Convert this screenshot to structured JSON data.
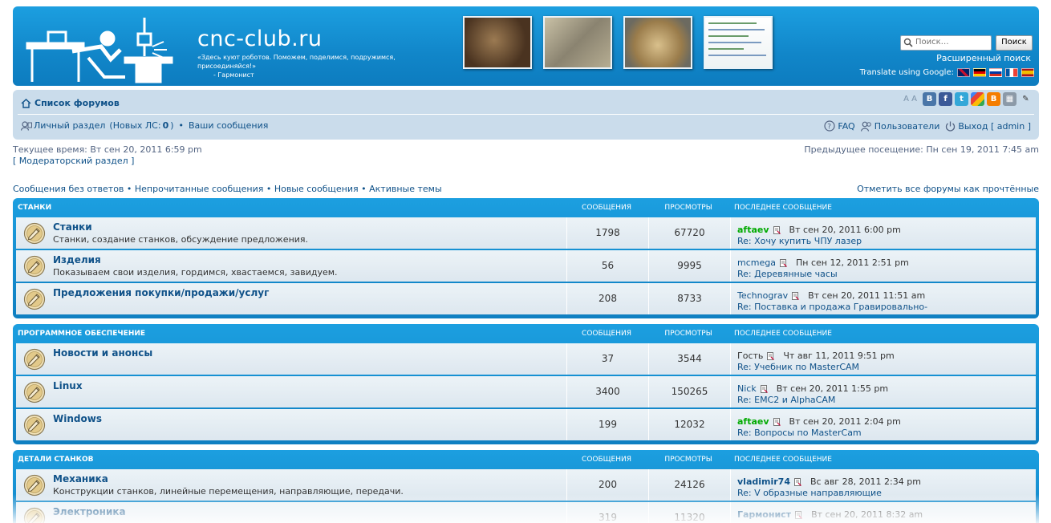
{
  "header": {
    "site_title": "cnc-club.ru",
    "site_description": "«Здесь куют роботов. Поможем, поделимся, подружимся, присоединяйся!»",
    "site_signature": "- Гармонист",
    "search_placeholder": "Поиск…",
    "search_button": "Поиск",
    "advanced_search": "Расширенный поиск",
    "translate_label": "Translate using Google:",
    "flags": [
      "flag-uk-icon",
      "flag-de-icon",
      "flag-ru-icon",
      "flag-fr-icon",
      "flag-es-icon"
    ]
  },
  "navbar": {
    "forum_index": "Список форумов",
    "font_size_control": "A A",
    "profile_link": "Личный раздел",
    "new_pm_prefix": "(Новых ЛС: ",
    "new_pm_count": "0",
    "new_pm_suffix": ")",
    "bullet": "•",
    "your_posts": "Ваши сообщения",
    "faq": "FAQ",
    "members": "Пользователи",
    "logout": "Выход [ admin ]",
    "share_icons": [
      "vkontakte-icon",
      "facebook-icon",
      "twitter-icon",
      "google-icon",
      "blogger-icon",
      "bookmark-icon",
      "edit-icon"
    ]
  },
  "info": {
    "current_time": "Текущее время: Вт сен 20, 2011 6:59 pm",
    "moderator_panel": "[ Модераторский раздел ]",
    "last_visit": "Предыдущее посещение: Пн сен 19, 2011 7:45 am",
    "quick_links": "Сообщения без ответов • Непрочитанные сообщения • Новые сообщения • Активные темы",
    "mark_read": "Отметить все форумы как прочтённые"
  },
  "columns": {
    "posts": "СООБЩЕНИЯ",
    "views": "ПРОСМОТРЫ",
    "last_post": "ПОСЛЕДНЕЕ СООБЩЕНИЕ"
  },
  "categories": [
    {
      "name": "СТАНКИ",
      "forums": [
        {
          "title": "Станки",
          "desc": "Станки, создание станков, обсуждение предложения.",
          "posts": "1798",
          "views": "67720",
          "user": "aftaev",
          "user_style": "green",
          "date": "Вт сен 20, 2011 6:00 pm",
          "topic": "Re: Хочу купить ЧПУ лазер"
        },
        {
          "title": "Изделия",
          "desc": "Показываем свои изделия, гордимся, хвастаемся, завидуем.",
          "posts": "56",
          "views": "9995",
          "user": "mcmega",
          "user_style": "plain",
          "date": "Пн сен 12, 2011 2:51 pm",
          "topic": "Re: Деревянные часы"
        },
        {
          "title": "Предложения покупки/продажи/услуг",
          "desc": "",
          "posts": "208",
          "views": "8733",
          "user": "Technograv",
          "user_style": "plain",
          "date": "Вт сен 20, 2011 11:51 am",
          "topic": "Re: Поставка и продажа Гравировально-"
        }
      ]
    },
    {
      "name": "ПРОГРАММНОЕ ОБЕСПЕЧЕНИЕ",
      "forums": [
        {
          "title": "Новости и анонсы",
          "desc": "",
          "posts": "37",
          "views": "3544",
          "user": "Гость",
          "user_style": "gray",
          "date": "Чт авг 11, 2011 9:51 pm",
          "topic": "Re: Учебник по MasterCAM"
        },
        {
          "title": "Linux",
          "desc": "",
          "posts": "3400",
          "views": "150265",
          "user": "Nick",
          "user_style": "plain",
          "date": "Вт сен 20, 2011 1:55 pm",
          "topic": "Re: EMC2 и AlphaCAM"
        },
        {
          "title": "Windows",
          "desc": "",
          "posts": "199",
          "views": "12032",
          "user": "aftaev",
          "user_style": "green",
          "date": "Вт сен 20, 2011 2:04 pm",
          "topic": "Re: Вопросы по MasterCam"
        }
      ]
    },
    {
      "name": "ДЕТАЛИ СТАНКОВ",
      "forums": [
        {
          "title": "Механика",
          "desc": "Конструкции станков, линейные перемещения, направляющие, передачи.",
          "posts": "200",
          "views": "24126",
          "user": "vladimir74",
          "user_style": "bold",
          "date": "Вс авг 28, 2011 2:34 pm",
          "topic": "Re: V образные направляющие"
        },
        {
          "title": "Электроника",
          "desc": "",
          "posts": "319",
          "views": "11320",
          "user": "Гармонист",
          "user_style": "bold",
          "date": "Вт сен 20, 2011 8:32 am",
          "topic": ""
        }
      ]
    }
  ]
}
